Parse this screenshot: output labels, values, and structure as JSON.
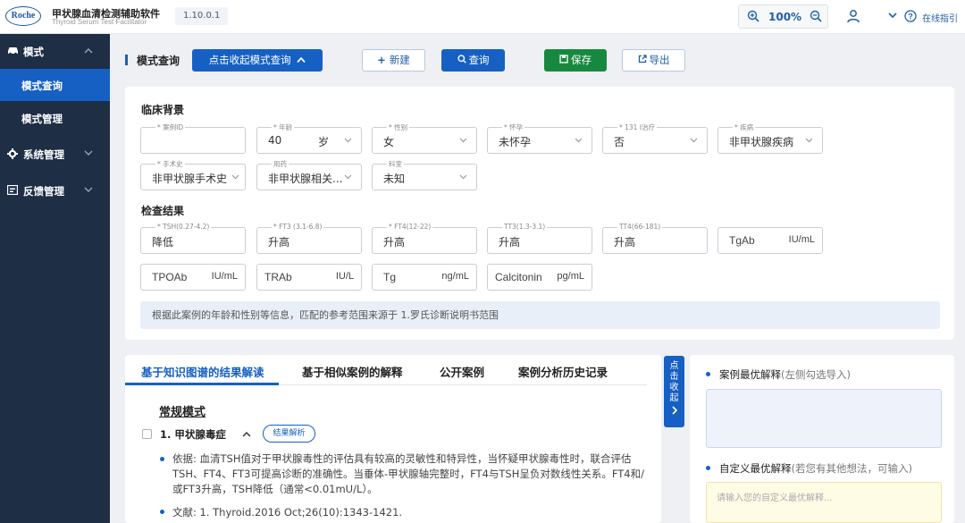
{
  "header": {
    "logo": "Roche",
    "app_title": "甲状腺血清检测辅助软件",
    "app_subtitle": "Thyroid Serum Test Facilitator",
    "version": "1.10.0.1",
    "zoom": "100%",
    "help_label": "在线指引"
  },
  "sidebar": {
    "items": [
      {
        "label": "模式",
        "icon": "car-icon"
      },
      {
        "label": "系统管理",
        "icon": "gear-icon"
      },
      {
        "label": "反馈管理",
        "icon": "feedback-icon"
      }
    ],
    "subitems": [
      {
        "label": "模式查询",
        "active": true
      },
      {
        "label": "模式管理",
        "active": false
      }
    ]
  },
  "toolbar": {
    "crumb": "模式查询",
    "collapse_label": "点击收起模式查询",
    "new_label": "新建",
    "query_label": "查询",
    "save_label": "保存",
    "export_label": "导出"
  },
  "clinical": {
    "title": "临床背景",
    "fields": [
      {
        "label": "* 案例ID",
        "value": ""
      },
      {
        "label": "* 年龄",
        "value": "40",
        "unit": "岁"
      },
      {
        "label": "* 性别",
        "value": "女"
      },
      {
        "label": "* 怀孕",
        "value": "未怀孕"
      },
      {
        "label": "* 131 I治疗",
        "value": "否"
      },
      {
        "label": "* 疾病",
        "value": "非甲状腺疾病"
      },
      {
        "label": "* 手术史",
        "value": "非甲状腺手术史"
      },
      {
        "label": "用药",
        "value": "非甲状腺相关..."
      },
      {
        "label": "科室",
        "value": "未知"
      }
    ]
  },
  "exam": {
    "title": "检查结果",
    "fields": [
      {
        "label": "* TSH(0.27-4.2)",
        "value": "降低"
      },
      {
        "label": "* FT3 (3.1-6.8)",
        "value": "升高"
      },
      {
        "label": "* FT4(12-22)",
        "value": "升高"
      },
      {
        "label": "TT3(1.3-3.1)",
        "value": "升高"
      },
      {
        "label": "TT4(66-181)",
        "value": "升高"
      },
      {
        "label": "",
        "value": "TgAb",
        "unit": "IU/mL"
      },
      {
        "label": "",
        "value": "TPOAb",
        "unit": "IU/mL"
      },
      {
        "label": "",
        "value": "TRAb",
        "unit": "IU/L"
      },
      {
        "label": "",
        "value": "Tg",
        "unit": "ng/mL"
      },
      {
        "label": "",
        "value": "Calcitonin",
        "unit": "pg/mL"
      }
    ],
    "note": "根据此案例的年龄和性别等信息，匹配的参考范围来源于 1.罗氏诊断说明书范围"
  },
  "results": {
    "tabs": [
      "基于知识图谱的结果解读",
      "基于相似案例的解释",
      "公开案例",
      "案例分析历史记录"
    ],
    "mode_title": "常规模式",
    "item_title": "1. 甲状腺毒症",
    "item_button": "结果解析",
    "basis": "依据: 血清TSH值对于甲状腺毒性的评估具有较高的灵敏性和特异性，当怀疑甲状腺毒性时，联合评估TSH、FT4、FT3可提高诊断的准确性。当垂体-甲状腺轴完整时，FT4与TSH呈负对数线性关系。FT4和/或FT3升高，TSH降低（通常<0.01mU/L）。",
    "reference": "文献: 1. Thyroid.2016 Oct;26(10):1343-1421."
  },
  "collapse_handle": "点击收起",
  "right_panel": {
    "best_label": "案例最优解释",
    "best_hint": "(左侧勾选导入)",
    "custom_label": "自定义最优解释",
    "custom_hint": "(若您有其他想法，可输入)",
    "custom_placeholder": "请输入您的自定义最优解释..."
  },
  "colors": {
    "primary": "#1660c4",
    "save": "#17893f",
    "sidebar": "#1d2e45"
  }
}
